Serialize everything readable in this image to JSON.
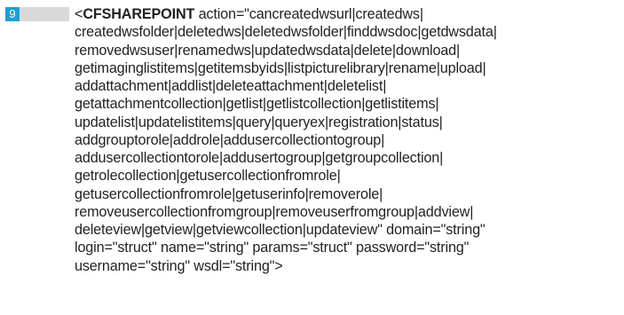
{
  "line_number": "9",
  "code": {
    "tag_open": "<",
    "tag_name": "CFSHAREPOINT",
    "first_line_rest": " action=\"cancreatedwsurl|createdws|",
    "lines": [
      "createdwsfolder|deletedws|deletedwsfolder|finddwsdoc|getdwsdata|",
      "removedwsuser|renamedws|updatedwsdata|delete|download|",
      "getimaginglistitems|getitemsbyids|listpicturelibrary|rename|upload|",
      "addattachment|addlist|deleteattachment|deletelist|",
      "getattachmentcollection|getlist|getlistcollection|getlistitems|",
      "updatelist|updatelistitems|query|queryex|registration|status|",
      "addgrouptorole|addrole|addusercollectiontogroup|",
      "addusercollectiontorole|addusertogroup|getgroupcollection|",
      "getrolecollection|getusercollectionfromrole|",
      "getusercollectionfromrole|getuserinfo|removerole|",
      "removeusercollectionfromgroup|removeuserfromgroup|addview|",
      "deleteview|getview|getviewcollection|updateview\" domain=\"string\"",
      "login=\"struct\" name=\"string\" params=\"struct\" password=\"string\"",
      "username=\"string\" wsdl=\"string\">"
    ]
  },
  "colors": {
    "line_number_bg": "#1f9fd2",
    "line_number_text": "#ffffff",
    "gutter_bar": "#d9d9d9",
    "code_text": "#231f20"
  }
}
